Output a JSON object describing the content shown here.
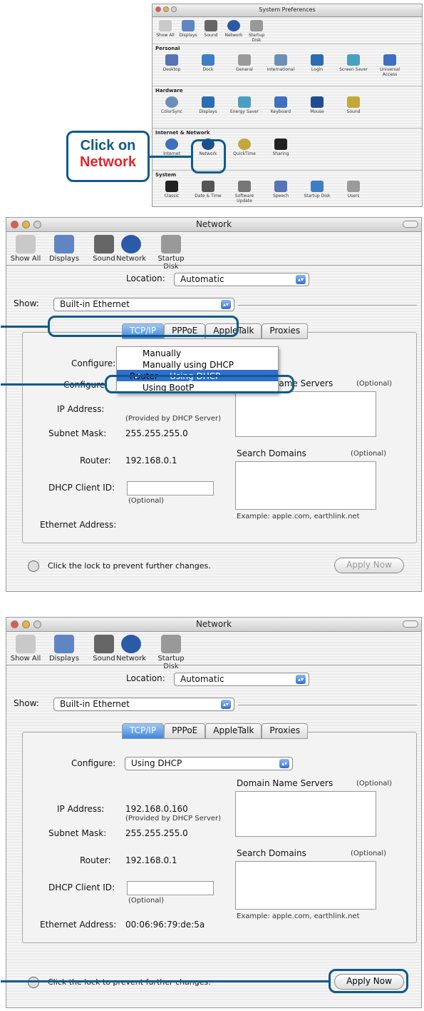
{
  "sysprefs": {
    "title": "System Preferences",
    "toolbar": [
      "Show All",
      "Displays",
      "Sound",
      "Network",
      "Startup Disk"
    ],
    "sections": [
      {
        "name": "Personal",
        "items": [
          "Desktop",
          "Dock",
          "General",
          "International",
          "Login",
          "Screen Saver",
          "Universal Access"
        ]
      },
      {
        "name": "Hardware",
        "items": [
          "ColorSync",
          "Displays",
          "Energy Saver",
          "Keyboard",
          "Mouse",
          "Sound"
        ]
      },
      {
        "name": "Internet & Network",
        "items": [
          "Internet",
          "Network",
          "QuickTime",
          "Sharing"
        ]
      },
      {
        "name": "System",
        "items": [
          "Classic",
          "Date & Time",
          "Software Update",
          "Speech",
          "Startup Disk",
          "Users"
        ]
      }
    ],
    "callout": {
      "line1": "Click on",
      "line2": "Network"
    }
  },
  "net1": {
    "title": "Network",
    "toolbar": [
      "Show All",
      "Displays",
      "Sound",
      "Network",
      "Startup Disk"
    ],
    "location_label": "Location:",
    "location_value": "Automatic",
    "show_label": "Show:",
    "show_value": "Built-in Ethernet",
    "tabs": [
      "TCP/IP",
      "PPPoE",
      "AppleTalk",
      "Proxies"
    ],
    "configure_label": "Configure:",
    "menu": [
      "Manually",
      "Manually using DHCP Router",
      "Using DHCP",
      "Using BootP"
    ],
    "dns_label": "Domain Name Servers",
    "optional": "(Optional)",
    "ip_label": "IP Address:",
    "ip_value": "",
    "provided": "(Provided by DHCP Server)",
    "subnet_label": "Subnet Mask:",
    "subnet_value": "255.255.255.0",
    "router_label": "Router:",
    "router_value": "192.168.0.1",
    "search_label": "Search Domains",
    "client_label": "DHCP Client ID:",
    "client_optional": "(Optional)",
    "example": "Example: apple.com, earthlink.net",
    "ether_label": "Ethernet Address:",
    "ether_value": "",
    "lock_text": "Click the lock to prevent further changes.",
    "apply": "Apply Now"
  },
  "net2": {
    "title": "Network",
    "toolbar": [
      "Show All",
      "Displays",
      "Sound",
      "Network",
      "Startup Disk"
    ],
    "location_label": "Location:",
    "location_value": "Automatic",
    "show_label": "Show:",
    "show_value": "Built-in Ethernet",
    "tabs": [
      "TCP/IP",
      "PPPoE",
      "AppleTalk",
      "Proxies"
    ],
    "configure_label": "Configure:",
    "configure_value": "Using DHCP",
    "dns_label": "Domain Name Servers",
    "optional": "(Optional)",
    "ip_label": "IP Address:",
    "ip_value": "192.168.0.160",
    "provided": "(Provided by DHCP Server)",
    "subnet_label": "Subnet Mask:",
    "subnet_value": "255.255.255.0",
    "router_label": "Router:",
    "router_value": "192.168.0.1",
    "search_label": "Search Domains",
    "client_label": "DHCP Client ID:",
    "client_optional": "(Optional)",
    "example": "Example: apple.com, earthlink.net",
    "ether_label": "Ethernet Address:",
    "ether_value": "00:06:96:79:de:5a",
    "lock_text": "Click the lock to prevent further changes.",
    "apply": "Apply Now"
  },
  "colors": {
    "callout": "#0e5a8a",
    "callout_red": "#e8232a",
    "highlight": "#2f6fcf"
  }
}
